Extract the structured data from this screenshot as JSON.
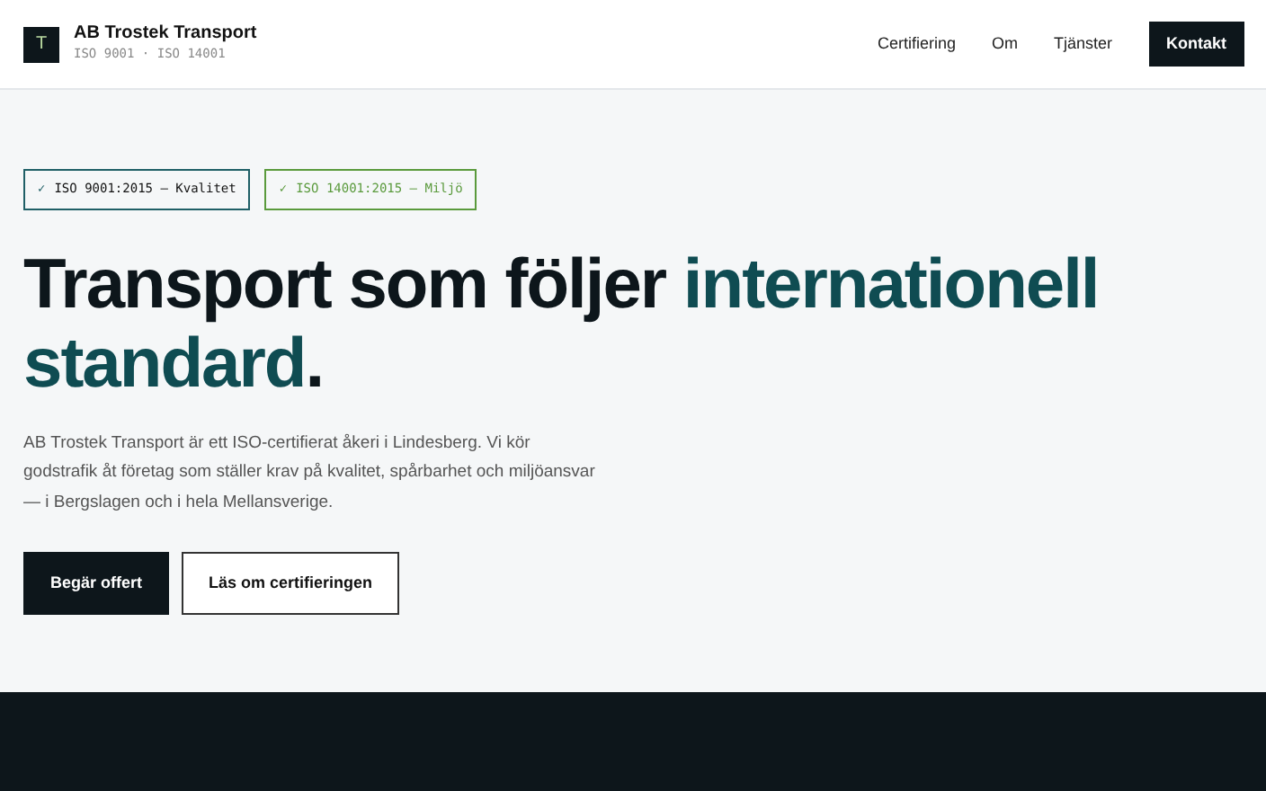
{
  "brand": {
    "logo_letter": "T",
    "name": "AB Trostek Transport",
    "tagline": "ISO 9001 · ISO 14001"
  },
  "nav": {
    "links": [
      "Certifiering",
      "Om",
      "Tjänster"
    ],
    "cta": "Kontakt"
  },
  "hero": {
    "badges": [
      {
        "check": "✓",
        "label": "ISO 9001:2015 — Kvalitet",
        "color": "#1f5f66"
      },
      {
        "check": "✓",
        "label": "ISO 14001:2015 — Miljö",
        "color": "#5a9a3c"
      }
    ],
    "headline": [
      {
        "text": "Transport som följer ",
        "accent": false
      },
      {
        "text": "internationell standard",
        "accent": true
      },
      {
        "text": ".",
        "accent": false
      }
    ],
    "intro": "AB Trostek Transport är ett ISO-certifierat åkeri i Lindesberg. Vi kör godstrafik åt företag som ställer krav på kvalitet, spårbarhet och miljöansvar — i Bergslagen och i hela Mellansverige.",
    "buttons": [
      {
        "label": "Begär offert",
        "kind": "primary"
      },
      {
        "label": "Läs om certifieringen",
        "kind": "outline"
      }
    ]
  }
}
